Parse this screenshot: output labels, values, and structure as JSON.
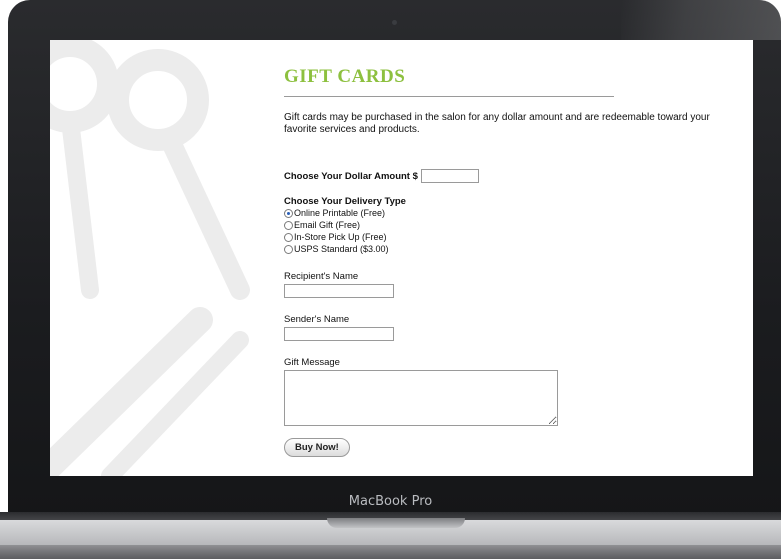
{
  "device": {
    "brand_label": "MacBook Pro"
  },
  "page": {
    "title": "GIFT CARDS",
    "intro": "Gift cards may be purchased in the salon for any dollar amount and are redeemable toward your favorite services and products.",
    "accent_color": "#8dc03f"
  },
  "form": {
    "amount": {
      "label": "Choose Your Dollar Amount $",
      "value": "",
      "placeholder": ""
    },
    "delivery": {
      "title": "Choose Your Delivery Type",
      "options": [
        {
          "label": "Online Printable (Free)",
          "checked": true
        },
        {
          "label": "Email Gift (Free)",
          "checked": false
        },
        {
          "label": "In-Store Pick Up (Free)",
          "checked": false
        },
        {
          "label": "USPS Standard ($3.00)",
          "checked": false
        }
      ]
    },
    "recipient": {
      "label": "Recipient's Name",
      "value": ""
    },
    "sender": {
      "label": "Sender's Name",
      "value": ""
    },
    "message": {
      "label": "Gift Message",
      "value": ""
    },
    "submit_label": "Buy Now!"
  }
}
